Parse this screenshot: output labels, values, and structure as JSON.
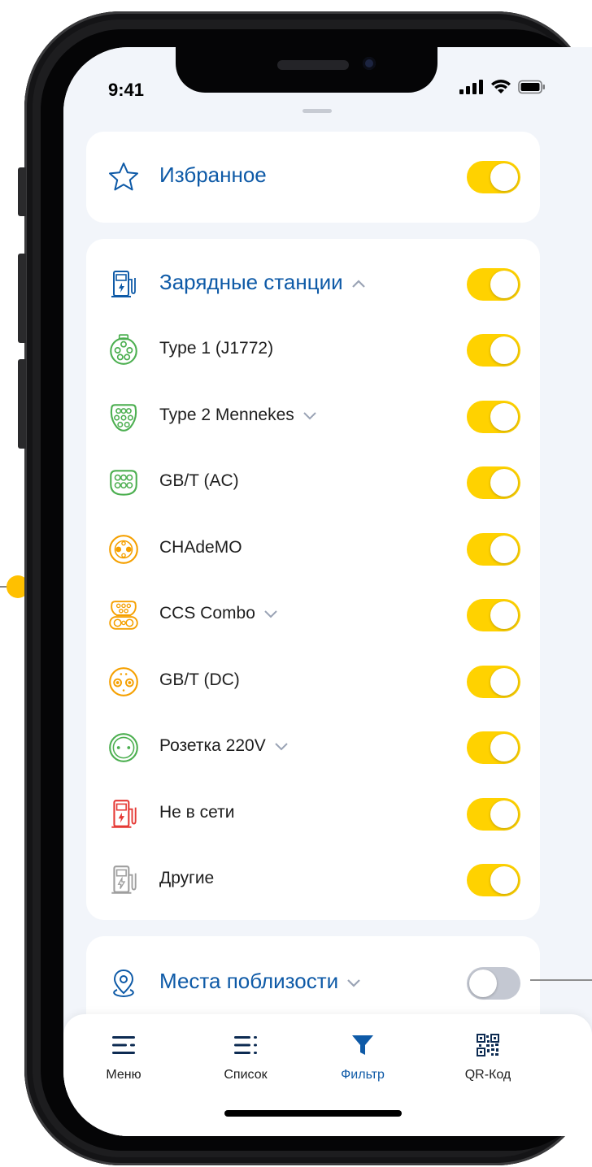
{
  "status_bar": {
    "time": "9:41"
  },
  "favorites": {
    "label": "Избранное",
    "enabled": true
  },
  "stations": {
    "label": "Зарядные станции",
    "enabled": true,
    "items": [
      {
        "label": "Type 1 (J1772)",
        "icon": "type1-connector-icon",
        "color": "#4caf50",
        "enabled": true,
        "expandable": false
      },
      {
        "label": "Type 2 Mennekes",
        "icon": "type2-connector-icon",
        "color": "#4caf50",
        "enabled": true,
        "expandable": true
      },
      {
        "label": "GB/T (AC)",
        "icon": "gbt-ac-connector-icon",
        "color": "#4caf50",
        "enabled": true,
        "expandable": false
      },
      {
        "label": "CHAdeMO",
        "icon": "chademo-connector-icon",
        "color": "#f5a000",
        "enabled": true,
        "expandable": false
      },
      {
        "label": "CCS Combo",
        "icon": "ccs-combo-connector-icon",
        "color": "#f5a000",
        "enabled": true,
        "expandable": true
      },
      {
        "label": "GB/T (DC)",
        "icon": "gbt-dc-connector-icon",
        "color": "#f5a000",
        "enabled": true,
        "expandable": false
      },
      {
        "label": "Розетка 220V",
        "icon": "socket-220v-icon",
        "color": "#4caf50",
        "enabled": true,
        "expandable": true
      },
      {
        "label": "Не в сети",
        "icon": "offline-station-icon",
        "color": "#e53935",
        "enabled": true,
        "expandable": false
      },
      {
        "label": "Другие",
        "icon": "other-station-icon",
        "color": "#9e9e9e",
        "enabled": true,
        "expandable": false
      }
    ]
  },
  "nearby": {
    "label": "Места поблизости",
    "enabled": false
  },
  "tabbar": {
    "items": [
      {
        "label": "Меню",
        "icon": "menu-icon",
        "active": false
      },
      {
        "label": "Список",
        "icon": "list-icon",
        "active": false
      },
      {
        "label": "Фильтр",
        "icon": "filter-icon",
        "active": true
      },
      {
        "label": "QR-Код",
        "icon": "qr-code-icon",
        "active": false
      }
    ]
  },
  "colors": {
    "accent": "#0e5aa7",
    "toggle_on": "#ffd200",
    "toggle_off": "#c4c8d2",
    "background": "#f2f5fa"
  }
}
